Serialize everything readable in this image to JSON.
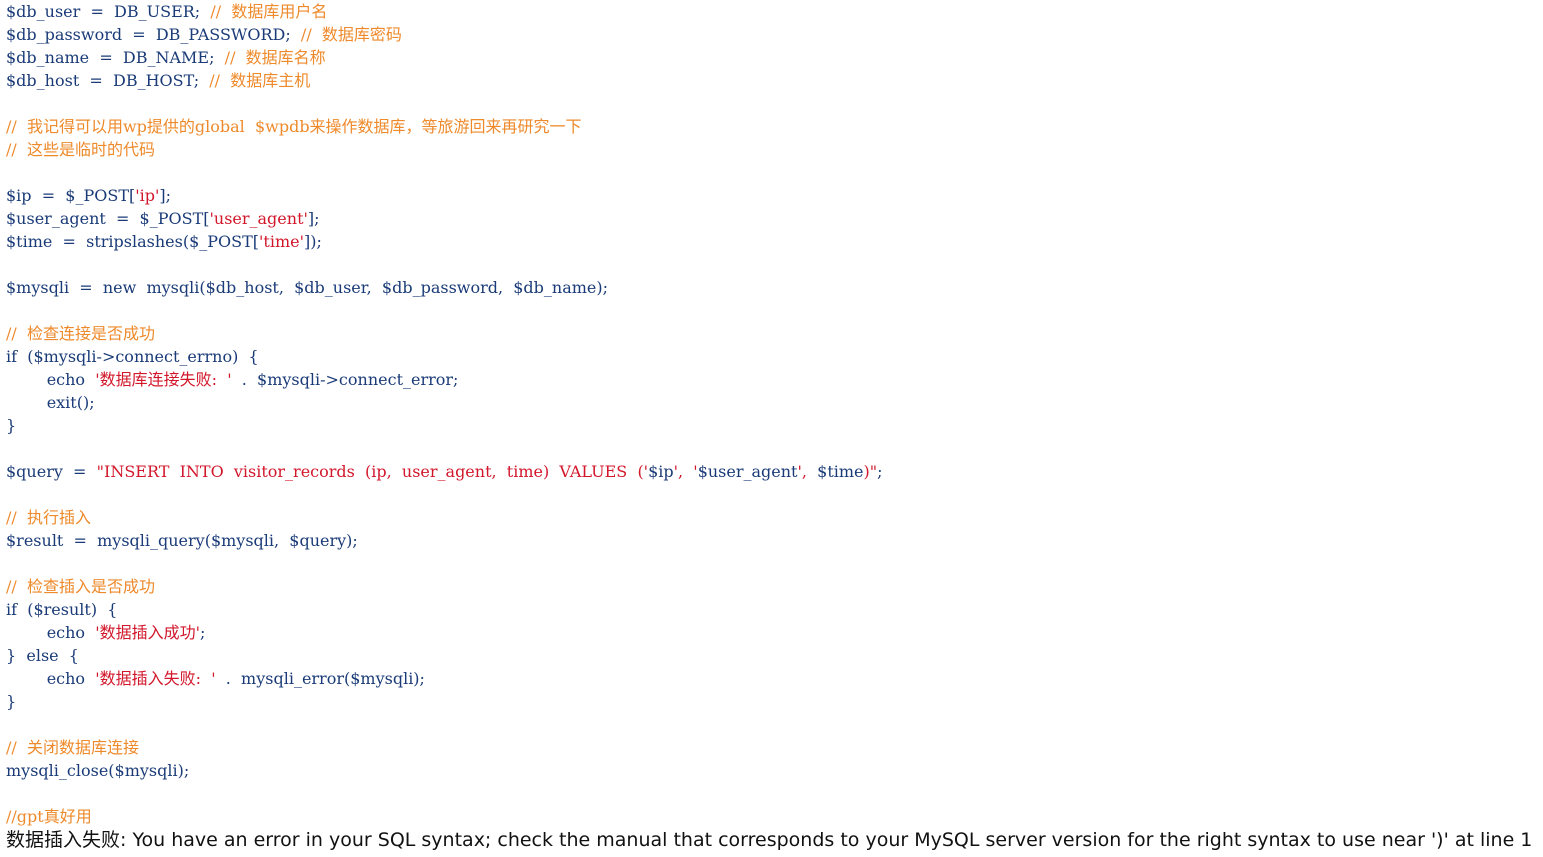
{
  "colors": {
    "background": "#ffffff",
    "code_default": "#1a3b78",
    "comment": "#ee8a2b",
    "string": "#d2172b",
    "output_text": "#111111"
  },
  "code_lines": [
    [
      {
        "t": "$db_user  =  DB_USER;  ",
        "c": "default"
      },
      {
        "t": "//  数据库用户名",
        "c": "comment"
      }
    ],
    [
      {
        "t": "$db_password  =  DB_PASSWORD;  ",
        "c": "default"
      },
      {
        "t": "//  数据库密码",
        "c": "comment"
      }
    ],
    [
      {
        "t": "$db_name  =  DB_NAME;  ",
        "c": "default"
      },
      {
        "t": "//  数据库名称",
        "c": "comment"
      }
    ],
    [
      {
        "t": "$db_host  =  DB_HOST;  ",
        "c": "default"
      },
      {
        "t": "//  数据库主机",
        "c": "comment"
      }
    ],
    [],
    [
      {
        "t": "//  我记得可以用wp提供的global  $wpdb来操作数据库，等旅游回来再研究一下",
        "c": "comment"
      }
    ],
    [
      {
        "t": "//  这些是临时的代码",
        "c": "comment"
      }
    ],
    [],
    [
      {
        "t": "$ip  =  $_POST[",
        "c": "default"
      },
      {
        "t": "'ip'",
        "c": "string"
      },
      {
        "t": "];",
        "c": "default"
      }
    ],
    [
      {
        "t": "$user_agent  =  $_POST[",
        "c": "default"
      },
      {
        "t": "'user_agent'",
        "c": "string"
      },
      {
        "t": "];",
        "c": "default"
      }
    ],
    [
      {
        "t": "$time  =  stripslashes($_POST[",
        "c": "default"
      },
      {
        "t": "'time'",
        "c": "string"
      },
      {
        "t": "]);",
        "c": "default"
      }
    ],
    [],
    [
      {
        "t": "$mysqli  =  new  mysqli($db_host,  $db_user,  $db_password,  $db_name);",
        "c": "default"
      }
    ],
    [],
    [
      {
        "t": "//  检查连接是否成功",
        "c": "comment"
      }
    ],
    [
      {
        "t": "if  ($mysqli->connect_errno)  {",
        "c": "default"
      }
    ],
    [
      {
        "t": "        echo  ",
        "c": "default"
      },
      {
        "t": "'数据库连接失败:  '",
        "c": "string"
      },
      {
        "t": "  .  $mysqli->connect_error;",
        "c": "default"
      }
    ],
    [
      {
        "t": "        exit();",
        "c": "default"
      }
    ],
    [
      {
        "t": "}",
        "c": "default"
      }
    ],
    [],
    [
      {
        "t": "$query  =  ",
        "c": "default"
      },
      {
        "t": "\"INSERT  INTO  visitor_records  (ip,  user_agent,  time)  VALUES  ('",
        "c": "string"
      },
      {
        "t": "$ip",
        "c": "default"
      },
      {
        "t": "',  '",
        "c": "string"
      },
      {
        "t": "$user_agent",
        "c": "default"
      },
      {
        "t": "',  ",
        "c": "string"
      },
      {
        "t": "$time",
        "c": "default"
      },
      {
        "t": ")\"",
        "c": "string"
      },
      {
        "t": ";",
        "c": "default"
      }
    ],
    [],
    [
      {
        "t": "//  执行插入",
        "c": "comment"
      }
    ],
    [
      {
        "t": "$result  =  mysqli_query($mysqli,  $query);",
        "c": "default"
      }
    ],
    [],
    [
      {
        "t": "//  检查插入是否成功",
        "c": "comment"
      }
    ],
    [
      {
        "t": "if  ($result)  {",
        "c": "default"
      }
    ],
    [
      {
        "t": "        echo  ",
        "c": "default"
      },
      {
        "t": "'数据插入成功'",
        "c": "string"
      },
      {
        "t": ";",
        "c": "default"
      }
    ],
    [
      {
        "t": "}  else  {",
        "c": "default"
      }
    ],
    [
      {
        "t": "        echo  ",
        "c": "default"
      },
      {
        "t": "'数据插入失败:  '",
        "c": "string"
      },
      {
        "t": "  .  mysqli_error($mysqli);",
        "c": "default"
      }
    ],
    [
      {
        "t": "}",
        "c": "default"
      }
    ],
    [],
    [
      {
        "t": "//  关闭数据库连接",
        "c": "comment"
      }
    ],
    [
      {
        "t": "mysqli_close($mysqli);",
        "c": "default"
      }
    ],
    [],
    [
      {
        "t": "//gpt真好用",
        "c": "comment"
      }
    ]
  ],
  "output": {
    "message": "数据插入失败: You have an error in your SQL syntax; check the manual that corresponds to your MySQL server version for the right syntax to use near ')' at line 1"
  }
}
